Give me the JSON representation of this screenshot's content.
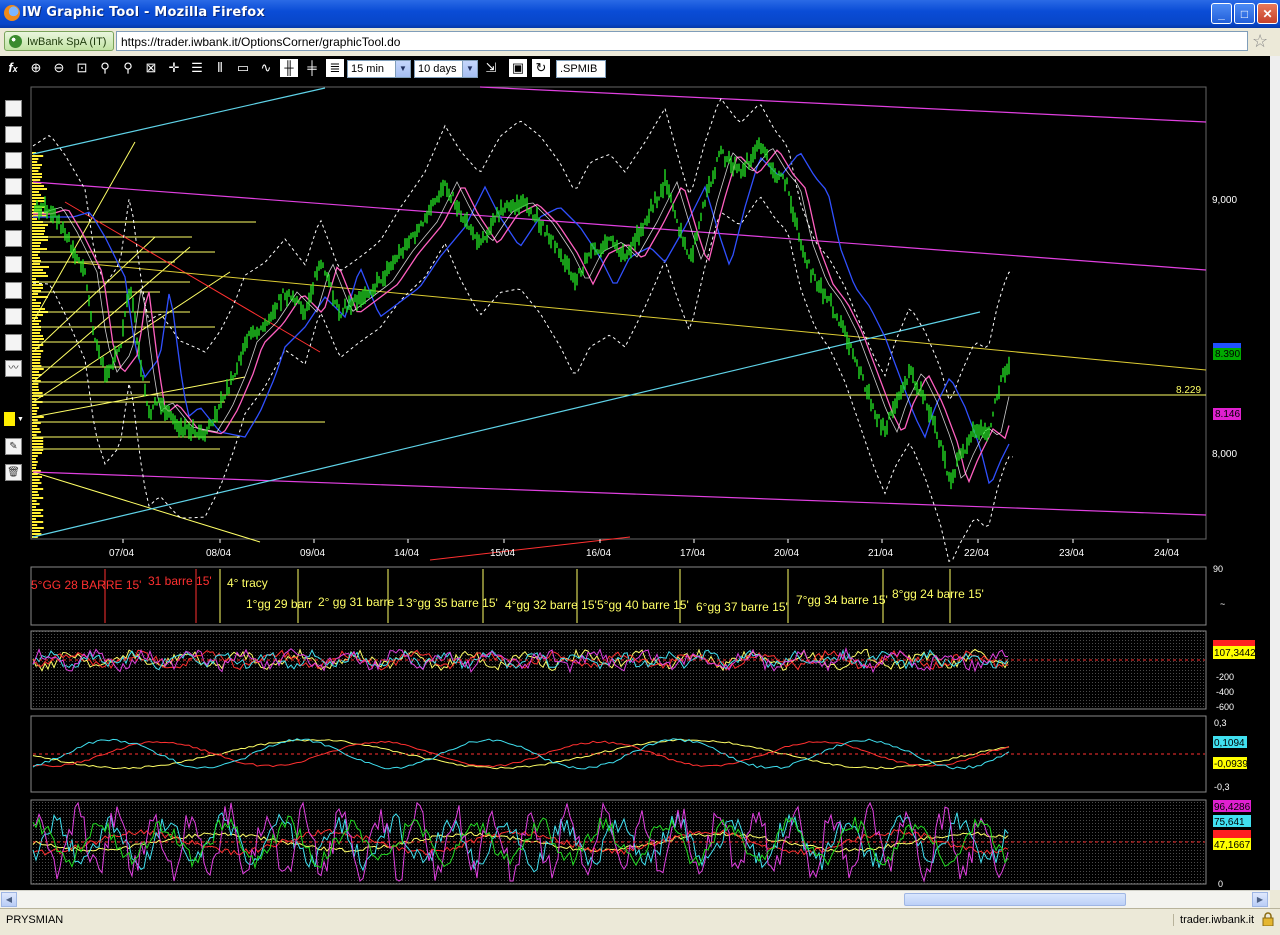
{
  "window": {
    "title": "IW Graphic Tool - Mozilla Firefox",
    "minimize": "_",
    "maximize": "□",
    "close": "✕"
  },
  "addressbar": {
    "identity": "IwBank SpA (IT)",
    "url": "https://trader.iwbank.it/OptionsCorner/graphicTool.do"
  },
  "toolbar": {
    "interval": "15 min",
    "period": "10 days",
    "symbol": ".SPMIB"
  },
  "chart": {
    "price_axis": [
      "9,000",
      "8,000"
    ],
    "price_tags": {
      "current": "8.390",
      "level": "8.229",
      "ma": "8.146"
    },
    "dates": [
      "07/04",
      "08/04",
      "09/04",
      "14/04",
      "15/04",
      "16/04",
      "17/04",
      "20/04",
      "21/04",
      "22/04",
      "23/04",
      "24/04"
    ],
    "annotations": [
      "5°GG 28 BARRE 15'",
      "31 barre 15'",
      "4° tracy",
      "1°gg 29 barr",
      "2° gg 31 barre 1",
      "3°gg 35 barre 15'",
      "4°gg 32 barre 15'",
      "5°gg 40 barre 15'",
      "6°gg 37 barre 15'",
      "7°gg 34 barre 15'",
      "8°gg 24 barre 15'"
    ],
    "cycle_axis": [
      "90"
    ],
    "osc1_axis": [
      "-200",
      "-400",
      "-600"
    ],
    "osc1_value": "107,3442",
    "osc2_axis": [
      "0,3",
      "-0,3"
    ],
    "osc2_values": [
      "0,1094",
      "-0,0939"
    ],
    "osc3_axis": [
      "0"
    ],
    "osc3_values": [
      "96,4286",
      "75,641",
      "47,1667"
    ]
  },
  "status": {
    "left": "PRYSMIAN",
    "right": "trader.iwbank.it"
  },
  "colors": {
    "candles": "#22dd22",
    "upper_channel": "#e040e0",
    "trend_line": "#5fd3e8",
    "ma_blue": "#3050ff",
    "ma_pink": "#ff60c0"
  }
}
